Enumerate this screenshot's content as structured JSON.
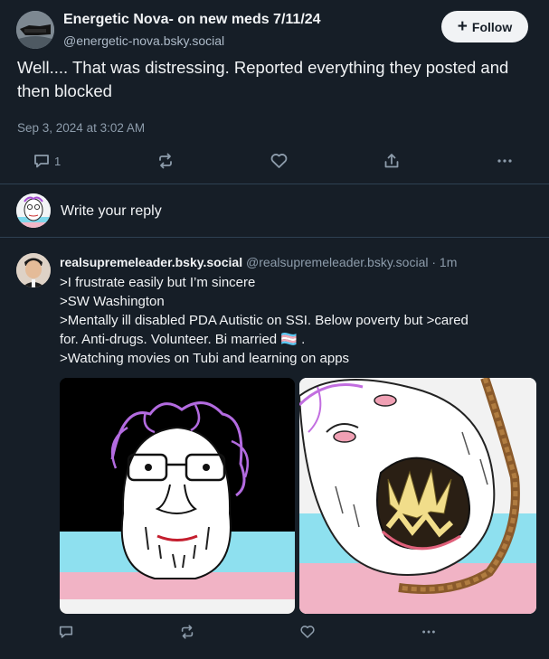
{
  "post": {
    "author_name": "Energetic Nova- on new meds 7/11/24",
    "author_handle": "@energetic-nova.bsky.social",
    "follow_label": "Follow",
    "text": "Well.... That was distressing. Reported everything they posted and then blocked",
    "timestamp": "Sep 3, 2024 at 3:02 AM",
    "reply_count": "1"
  },
  "compose": {
    "placeholder": "Write your reply"
  },
  "reply": {
    "author_name": "realsupremeleader.bsky.social",
    "meta": "@realsupremeleader.bsky.social · 1m",
    "lines": [
      ">I frustrate easily but I’m sincere",
      ">SW Washington",
      ">Mentally ill disabled PDA Autistic on SSI.  Below poverty but >cared",
      "for. Anti-drugs. Volunteer. Bi married",
      ">Watching movies on Tubi and learning on apps"
    ],
    "line4_suffix": "🏳️‍⚧️ .",
    "images": [
      "meme-drawing-left",
      "meme-drawing-right"
    ]
  },
  "colors": {
    "background": "#161e27",
    "divider": "#2e4052",
    "text": "#f1f3f5",
    "muted": "#8d9cab",
    "follow_bg": "#f1f3f5"
  },
  "icons": [
    "reply-icon",
    "repost-icon",
    "like-icon",
    "share-icon",
    "more-icon",
    "plus-icon"
  ]
}
